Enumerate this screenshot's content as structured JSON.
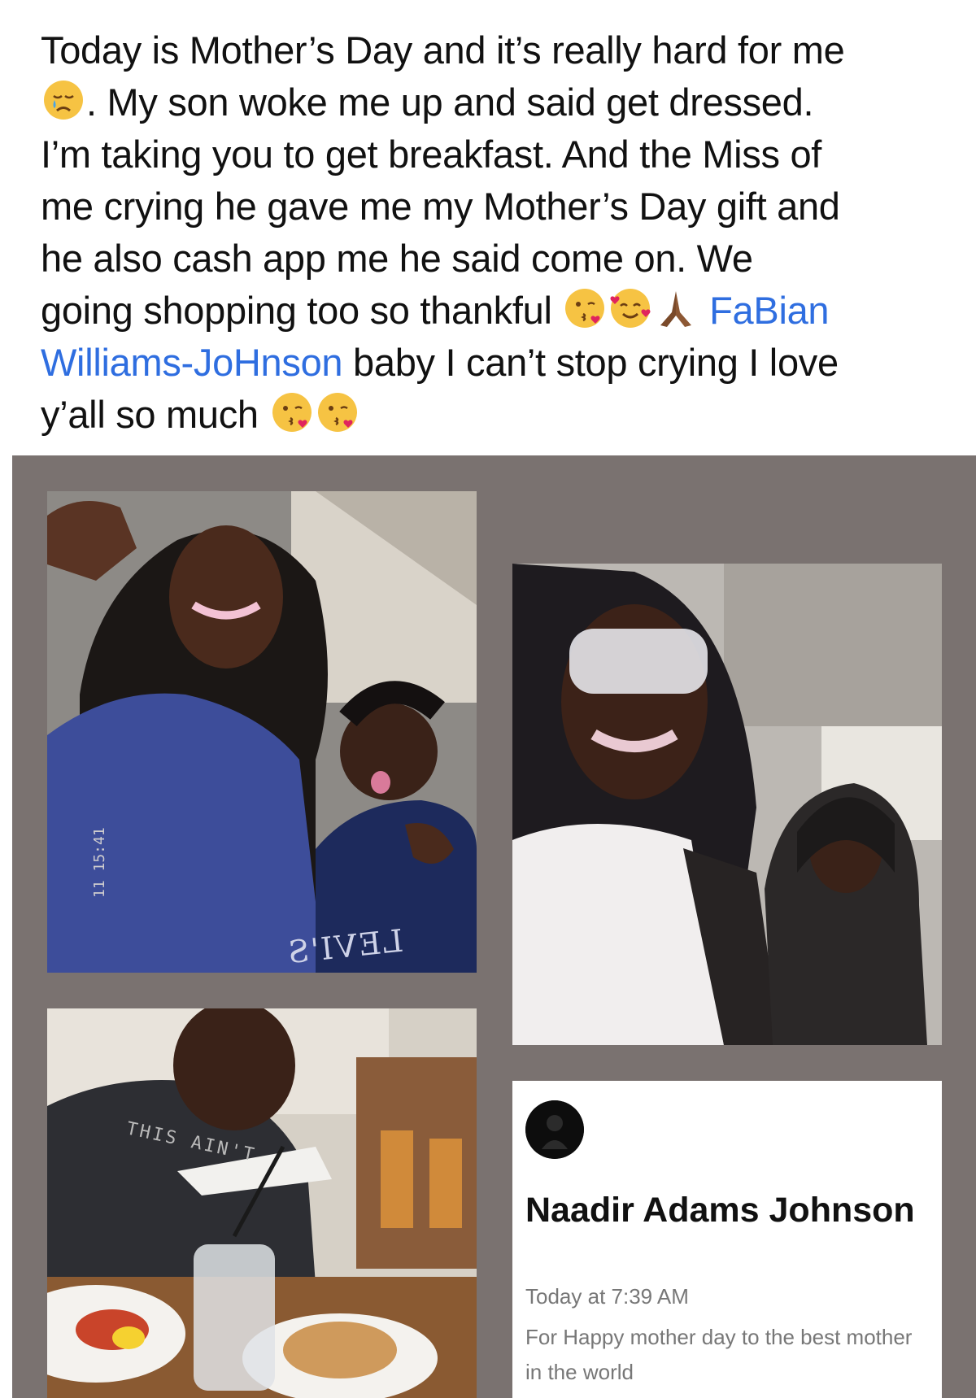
{
  "post": {
    "line1": "Today is Mother’s Day and it’s really hard for me",
    "line2": ". My son woke me up and said get dressed.",
    "line3": "I’m taking you to get breakfast. And the Miss of",
    "line4": "me crying he gave me my Mother’s Day gift and",
    "line5": "he also cash app me he said come on. We",
    "line6_text": "going shopping too so thankful",
    "mention_part1": "FaBian",
    "mention_part2": "Williams-JoHnson",
    "line7_rest": " baby I can’t stop crying I love",
    "line8": "y’all so much",
    "emojis": [
      "crying-face",
      "face-blowing-kiss",
      "smiling-face-with-hearts",
      "folded-hands",
      "face-blowing-kiss",
      "face-blowing-kiss"
    ]
  },
  "collage": {
    "photo1_timestamp": "11 15:41",
    "photo1_shirt_text": "LEVI'S",
    "photo3_shirt_text": "THIS AIN'T"
  },
  "card": {
    "name": "Naadir Adams Johnson",
    "time": "Today at 7:39 AM",
    "message": "For Happy mother day to the best mother in the world"
  },
  "colors": {
    "mention": "#2f6ee0",
    "collage_bg": "#7a7270",
    "meta_text": "#777777"
  }
}
